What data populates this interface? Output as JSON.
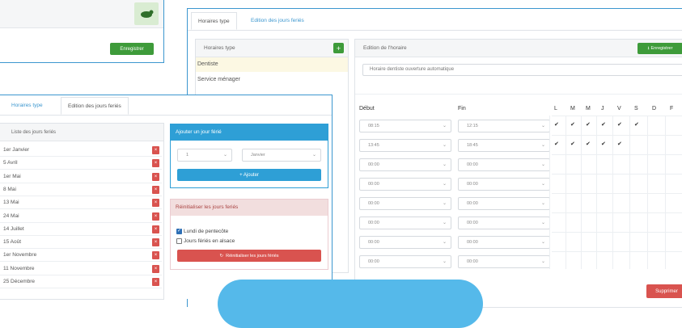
{
  "top_left": {
    "save_label": "Enregistrer"
  },
  "main": {
    "tabs": [
      "Horaires type",
      "Edition des jours feriés"
    ],
    "list_title": "Horaires type",
    "list_items": [
      "Dentiste",
      "Service ménager"
    ],
    "edit_title": "Edition de l'horaire",
    "save_label": "Enregistrer",
    "name_value": "Horaire dentiste ouverture automatique",
    "col_start": "Début",
    "col_end": "Fin",
    "days": [
      "L",
      "M",
      "M",
      "J",
      "V",
      "S",
      "D",
      "F"
    ],
    "rows": [
      {
        "start": "08:15",
        "end": "12:15",
        "checks": [
          true,
          true,
          true,
          true,
          true,
          true,
          false,
          false
        ]
      },
      {
        "start": "13:45",
        "end": "18:45",
        "checks": [
          true,
          true,
          true,
          true,
          true,
          false,
          false,
          false
        ]
      },
      {
        "start": "00:00",
        "end": "00:00",
        "checks": [
          false,
          false,
          false,
          false,
          false,
          false,
          false,
          false
        ]
      },
      {
        "start": "00:00",
        "end": "00:00",
        "checks": [
          false,
          false,
          false,
          false,
          false,
          false,
          false,
          false
        ]
      },
      {
        "start": "00:00",
        "end": "00:00",
        "checks": [
          false,
          false,
          false,
          false,
          false,
          false,
          false,
          false
        ]
      },
      {
        "start": "00:00",
        "end": "00:00",
        "checks": [
          false,
          false,
          false,
          false,
          false,
          false,
          false,
          false
        ]
      },
      {
        "start": "00:00",
        "end": "00:00",
        "checks": [
          false,
          false,
          false,
          false,
          false,
          false,
          false,
          false
        ]
      },
      {
        "start": "00:00",
        "end": "00:00",
        "checks": [
          false,
          false,
          false,
          false,
          false,
          false,
          false,
          false
        ]
      }
    ],
    "delete_label": "Supprimer"
  },
  "holidays": {
    "tabs": [
      "Horaires type",
      "Edition des jours feriés"
    ],
    "list_title": "Liste des jours feriés",
    "items": [
      "1er Janvier",
      "5 Avril",
      "1er Mai",
      "8 Mai",
      "13 Mai",
      "24 Mai",
      "14 Juillet",
      "15 Août",
      "1er Novembre",
      "11 Novembre",
      "25 Décembre"
    ],
    "add_title": "Ajouter un jour férié",
    "day_value": "1",
    "month_value": "Janvier",
    "add_button": "+ Ajouter",
    "reset_title": "Réinitialiser les jours feriés",
    "options": [
      {
        "label": "Lundi de pentecôte",
        "checked": true
      },
      {
        "label": "Jours fériés en alsace",
        "checked": false
      }
    ],
    "reset_button": "Réinitialiser les jours fériés"
  },
  "colors": {
    "green": "#3e9b3a",
    "blue": "#2e9fd6",
    "red": "#d9534f",
    "pink": "#f2dede",
    "banner": "#55b9ea"
  }
}
